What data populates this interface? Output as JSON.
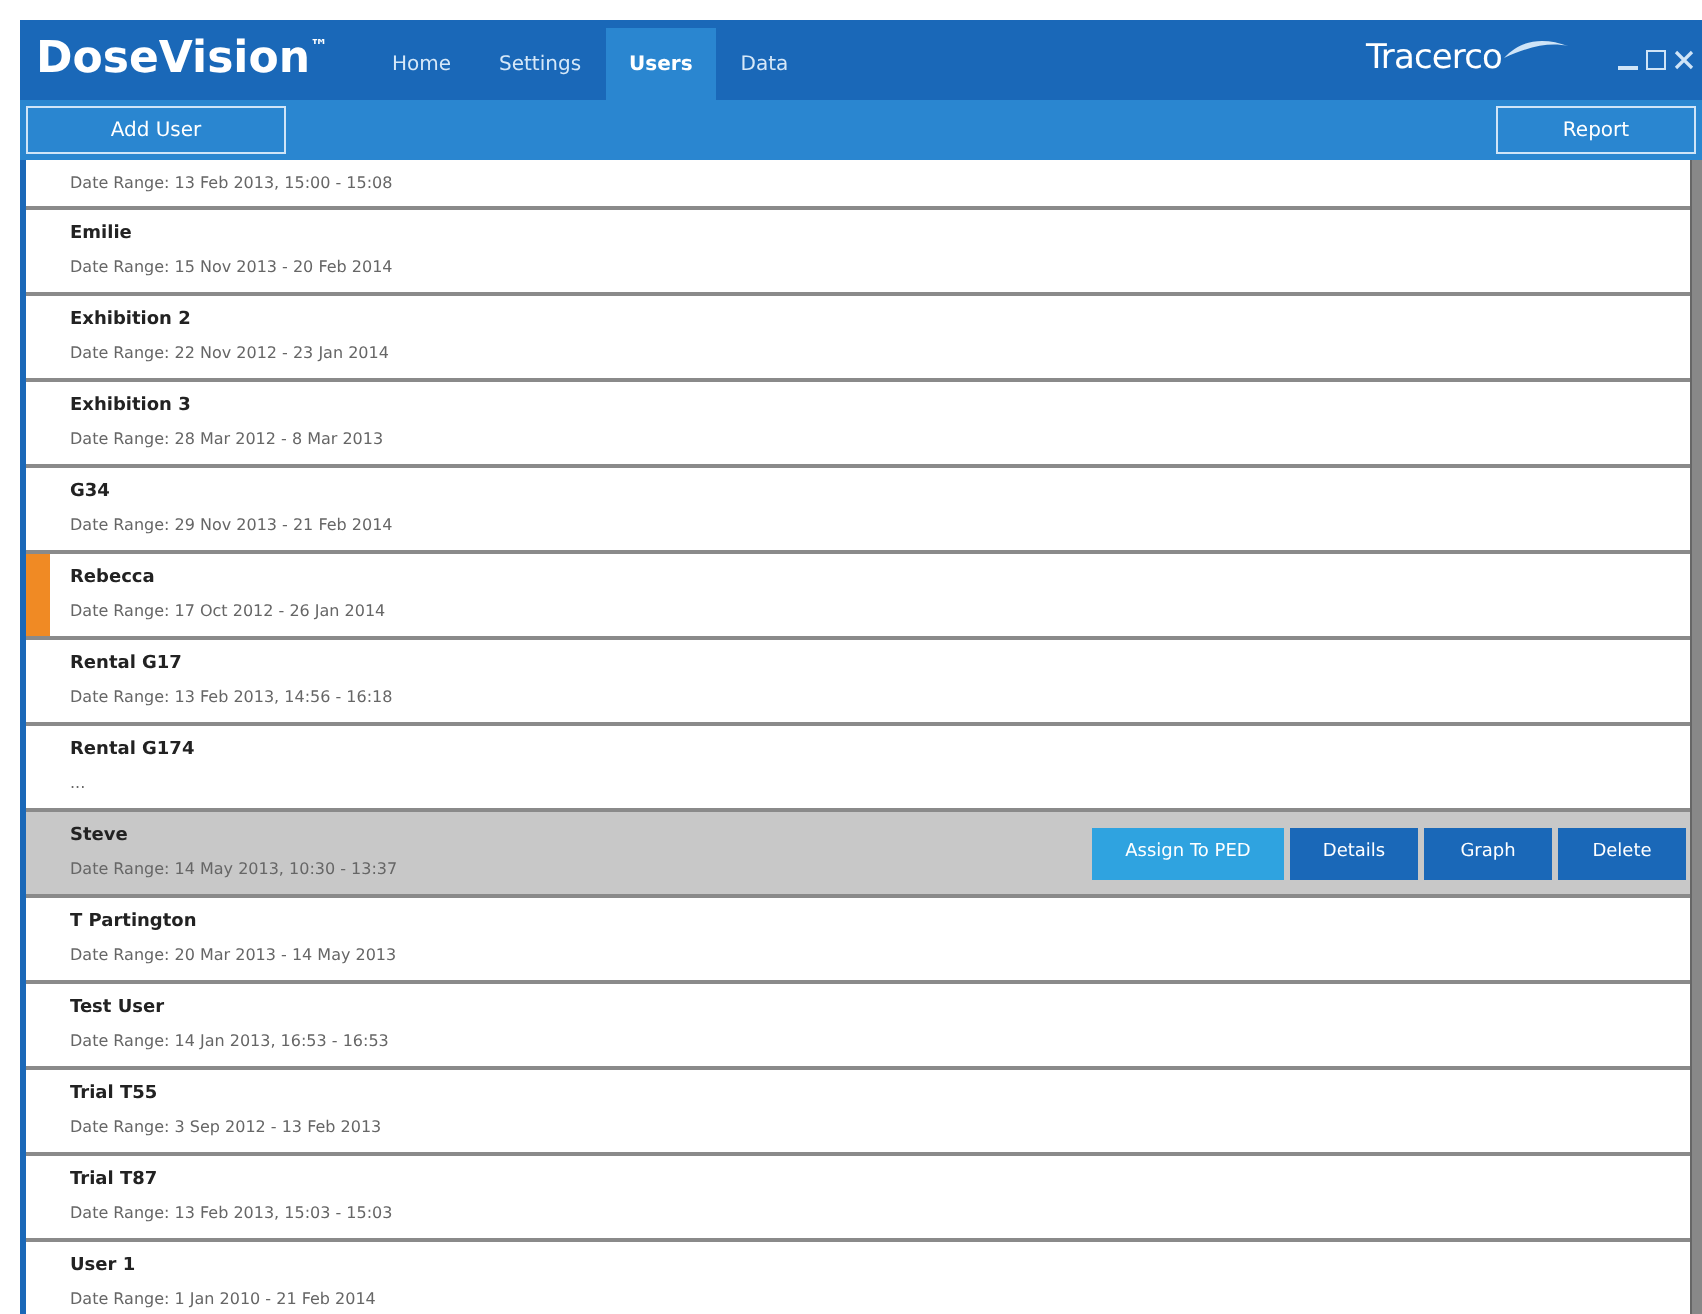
{
  "app": {
    "title": "DoseVision",
    "trademark": "™",
    "brand": "Tracerco"
  },
  "tabs": [
    {
      "label": "Home",
      "selected": false
    },
    {
      "label": "Settings",
      "selected": false
    },
    {
      "label": "Users",
      "selected": true
    },
    {
      "label": "Data",
      "selected": false
    }
  ],
  "toolbar": {
    "left_button": "Add User",
    "right_button": "Report"
  },
  "users": [
    {
      "date_range": "Date Range: 13 Feb 2013, 15:00 - 15:08",
      "flagged": false,
      "selected": false
    },
    {
      "name": "Emilie",
      "date_range": "Date Range: 15 Nov 2013 - 20 Feb 2014",
      "flagged": false,
      "selected": false
    },
    {
      "name": "Exhibition 2",
      "date_range": "Date Range: 22 Nov 2012 - 23 Jan 2014",
      "flagged": false,
      "selected": false
    },
    {
      "name": "Exhibition 3",
      "date_range": "Date Range: 28 Mar 2012 - 8 Mar 2013",
      "flagged": false,
      "selected": false
    },
    {
      "name": "G34",
      "date_range": "Date Range: 29 Nov 2013 - 21 Feb 2014",
      "flagged": false,
      "selected": false
    },
    {
      "name": "Rebecca",
      "date_range": "Date Range: 17 Oct 2012 - 26 Jan 2014",
      "flagged": true,
      "selected": false
    },
    {
      "name": "Rental G17",
      "date_range": "Date Range: 13 Feb 2013, 14:56 - 16:18",
      "flagged": false,
      "selected": false
    },
    {
      "name": "Rental G174",
      "date_range": "...",
      "flagged": false,
      "selected": false
    },
    {
      "name": "Steve",
      "date_range": "Date Range: 14 May 2013, 10:30 - 13:37",
      "flagged": false,
      "selected": true
    },
    {
      "name": "T Partington",
      "date_range": "Date Range: 20 Mar 2013 - 14 May 2013",
      "flagged": false,
      "selected": false
    },
    {
      "name": "Test User",
      "date_range": "Date Range: 14 Jan 2013, 16:53 - 16:53",
      "flagged": false,
      "selected": false
    },
    {
      "name": "Trial T55",
      "date_range": "Date Range: 3 Sep 2012 - 13 Feb 2013",
      "flagged": false,
      "selected": false
    },
    {
      "name": "Trial T87",
      "date_range": "Date Range: 13 Feb 2013, 15:03 - 15:03",
      "flagged": false,
      "selected": false
    },
    {
      "name": "User 1",
      "date_range": "Date Range: 1 Jan 2010 - 21 Feb 2014",
      "flagged": false,
      "selected": false
    }
  ],
  "row_actions": [
    {
      "label": "Assign To PED",
      "kind": "primary"
    },
    {
      "label": "Details",
      "kind": "normal"
    },
    {
      "label": "Graph",
      "kind": "normal"
    },
    {
      "label": "Delete",
      "kind": "normal"
    }
  ]
}
